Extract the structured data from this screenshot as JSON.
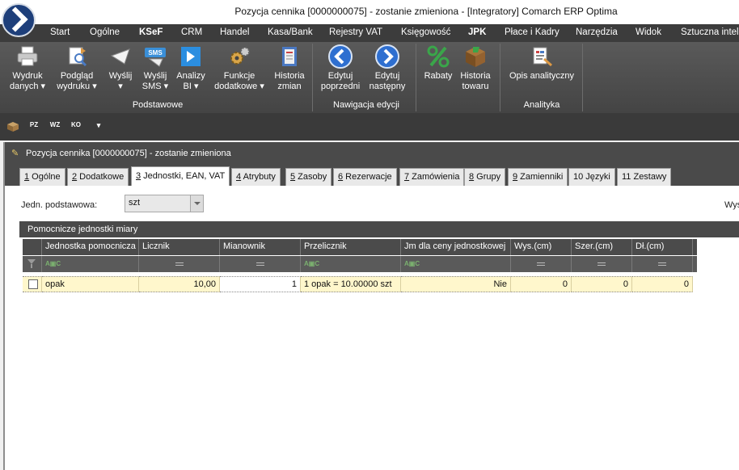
{
  "window": {
    "title": "Pozycja cennika [0000000075] - zostanie zmieniona - [Integratory] Comarch ERP Optima"
  },
  "menu": [
    {
      "label": "Start",
      "bold": false
    },
    {
      "label": "Ogólne",
      "bold": false
    },
    {
      "label": "KSeF",
      "bold": true
    },
    {
      "label": "CRM",
      "bold": false
    },
    {
      "label": "Handel",
      "bold": false
    },
    {
      "label": "Kasa/Bank",
      "bold": false
    },
    {
      "label": "Rejestry VAT",
      "bold": false
    },
    {
      "label": "Księgowość",
      "bold": false
    },
    {
      "label": "JPK",
      "bold": true
    },
    {
      "label": "Płace i Kadry",
      "bold": false
    },
    {
      "label": "Narzędzia",
      "bold": false
    },
    {
      "label": "Widok",
      "bold": false
    },
    {
      "label": "Sztuczna inteligencja",
      "bold": false
    }
  ],
  "ribbon": {
    "buttons": [
      {
        "line1": "Wydruk",
        "line2": "danych ▾",
        "icon": "printer-icon"
      },
      {
        "line1": "Podgląd",
        "line2": "wydruku ▾",
        "icon": "print-preview-icon"
      },
      {
        "line1": "Wyślij",
        "line2": "▾",
        "icon": "send-icon"
      },
      {
        "line1": "Wyślij",
        "line2": "SMS ▾",
        "icon": "sms-icon"
      },
      {
        "line1": "Analizy",
        "line2": "BI ▾",
        "icon": "bi-icon"
      },
      {
        "line1": "Funkcje",
        "line2": "dodatkowe ▾",
        "icon": "gears-icon"
      },
      {
        "line1": "Historia",
        "line2": "zmian",
        "icon": "history-icon"
      },
      {
        "line1": "Edytuj",
        "line2": "poprzedni",
        "icon": "arrow-left-icon"
      },
      {
        "line1": "Edytuj",
        "line2": "następny",
        "icon": "arrow-right-icon"
      },
      {
        "line1": "Rabaty",
        "line2": "",
        "icon": "percent-icon"
      },
      {
        "line1": "Historia",
        "line2": "towaru",
        "icon": "product-history-icon"
      },
      {
        "line1": "Opis analityczny",
        "line2": "",
        "icon": "analytic-description-icon"
      }
    ],
    "groups": [
      "Podstawowe",
      "Nawigacja edycji",
      "Analityka"
    ]
  },
  "quick_access": [
    "PZ",
    "WZ",
    "KO"
  ],
  "form": {
    "window_title": "Pozycja cennika [0000000075] - zostanie zmieniona",
    "tabs": [
      {
        "num": "1",
        "label": " Ogólne",
        "active": false
      },
      {
        "num": "2",
        "label": " Dodatkowe",
        "active": false
      },
      {
        "num": "3",
        "label": " Jednostki, EAN, VAT",
        "active": true
      },
      {
        "num": "4",
        "label": " Atrybuty",
        "active": false
      },
      {
        "num": "5",
        "label": " Zasoby",
        "active": false
      },
      {
        "num": "6",
        "label": " Rezerwacje",
        "active": false
      },
      {
        "num": "7",
        "label": " Zamówienia",
        "active": false
      },
      {
        "num": "8",
        "label": " Grupy",
        "active": false
      },
      {
        "num": "9",
        "label": " Zamienniki",
        "active": false
      },
      {
        "num": "",
        "label": "10 Języki",
        "active": false
      },
      {
        "num": "",
        "label": "11 Zestawy",
        "active": false
      }
    ],
    "base_unit_label": "Jedn. podstawowa:",
    "base_unit_value": "szt",
    "right_label": "Wys",
    "section_title": "Pomocnicze jednostki miary"
  },
  "table": {
    "columns": [
      "Jednostka pomocnicza",
      "Licznik",
      "Mianownik",
      "Przelicznik",
      "Jm dla ceny jednostkowej",
      "Wys.(cm)",
      "Szer.(cm)",
      "Dł.(cm)"
    ],
    "rows": [
      [
        "opak",
        "10,00",
        "1",
        "1 opak = 10.00000 szt",
        "Nie",
        "0",
        "0",
        "0"
      ]
    ]
  }
}
